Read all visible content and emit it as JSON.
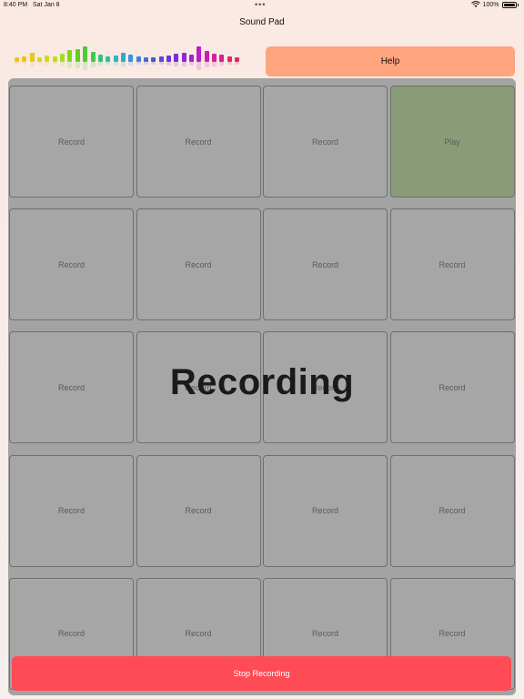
{
  "status_bar": {
    "time": "8:40 PM",
    "date": "Sat Jan 8",
    "battery": "100%",
    "wifi_icon": "wifi-icon",
    "battery_icon": "battery-icon"
  },
  "title": "Sound Pad",
  "help_label": "Help",
  "meter_colors": [
    "#f3c316",
    "#f3c316",
    "#e8c917",
    "#e2d41b",
    "#d3d91e",
    "#c2dc21",
    "#a6dd21",
    "#7ed822",
    "#5dd121",
    "#4ccd32",
    "#3ccb52",
    "#2ec873",
    "#2cc295",
    "#2fb7b3",
    "#33a7cc",
    "#3894df",
    "#3c80e6",
    "#3f6ce4",
    "#4657de",
    "#5446db",
    "#6538da",
    "#7a2ed8",
    "#9127d6",
    "#a720d1",
    "#bb1fc6",
    "#cb1fb3",
    "#d6219b",
    "#db2385",
    "#df2670",
    "#e22960"
  ],
  "meter_levels": [
    0.25,
    0.35,
    0.55,
    0.3,
    0.4,
    0.35,
    0.5,
    0.7,
    0.8,
    0.95,
    0.6,
    0.45,
    0.35,
    0.4,
    0.55,
    0.45,
    0.35,
    0.3,
    0.3,
    0.35,
    0.4,
    0.5,
    0.55,
    0.45,
    0.95,
    0.65,
    0.5,
    0.45,
    0.35,
    0.3
  ],
  "pads": [
    [
      "Record",
      "Record",
      "Record",
      "Play"
    ],
    [
      "Record",
      "Record",
      "Record",
      "Record"
    ],
    [
      "Record",
      "Record",
      "Record",
      "Record"
    ],
    [
      "Record",
      "Record",
      "Record",
      "Record"
    ],
    [
      "Record",
      "Record",
      "Record",
      "Record"
    ]
  ],
  "overlay_text": "Recording",
  "stop_label": "Stop Recording",
  "colors": {
    "help": "#fea47f",
    "stop": "#fe4b56",
    "pad": "#a6a6a6",
    "play_pad": "#8a9b78"
  }
}
